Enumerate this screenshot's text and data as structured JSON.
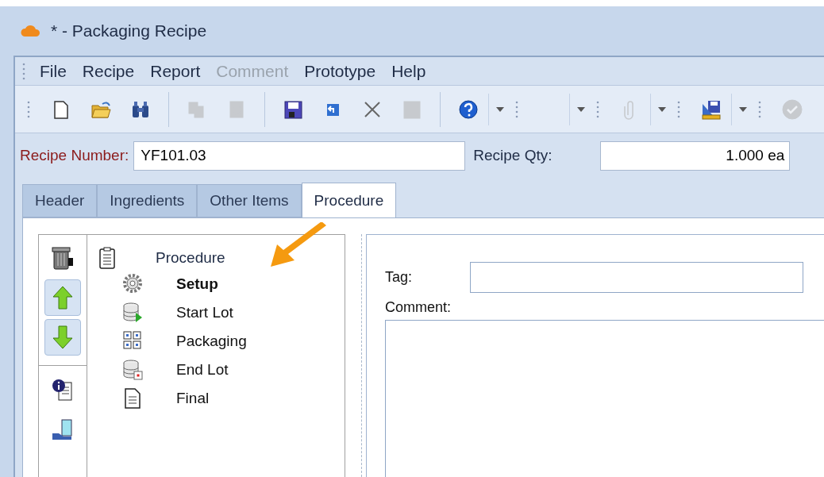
{
  "window": {
    "title": "* - Packaging Recipe"
  },
  "menu": [
    {
      "label": "File",
      "disabled": false
    },
    {
      "label": "Recipe",
      "disabled": false
    },
    {
      "label": "Report",
      "disabled": false
    },
    {
      "label": "Comment",
      "disabled": true
    },
    {
      "label": "Prototype",
      "disabled": false
    },
    {
      "label": "Help",
      "disabled": false
    }
  ],
  "toolbars": [
    {
      "groups": [
        [
          {
            "kind": "button",
            "disabled": false
          },
          {
            "kind": "button",
            "disabled": false
          },
          {
            "kind": "button",
            "disabled": false
          }
        ],
        [
          {
            "kind": "button",
            "disabled": true
          },
          {
            "kind": "button",
            "disabled": true
          }
        ],
        [
          {
            "kind": "button",
            "disabled": false
          },
          {
            "kind": "button",
            "disabled": false
          },
          {
            "kind": "button",
            "disabled": false
          },
          {
            "kind": "button",
            "disabled": true
          }
        ],
        [
          {
            "kind": "button",
            "disabled": false
          },
          {
            "kind": "dropdown"
          }
        ]
      ]
    },
    {
      "groups": [
        [
          {
            "kind": "blank"
          },
          {
            "kind": "dropdown"
          }
        ]
      ]
    },
    {
      "groups": [
        [
          {
            "kind": "button",
            "disabled": true
          },
          {
            "kind": "dropdown"
          }
        ]
      ]
    },
    {
      "groups": [
        [
          {
            "kind": "button",
            "disabled": false
          },
          {
            "kind": "dropdown"
          }
        ]
      ]
    },
    {
      "groups": [
        [
          {
            "kind": "button",
            "disabled": true
          }
        ]
      ]
    }
  ],
  "recipe_number": {
    "label": "Recipe Number:",
    "value": "YF101.03",
    "required": true
  },
  "recipe_qty": {
    "label": "Recipe Qty:",
    "value": "1.000 ea",
    "required": false
  },
  "tabs": [
    {
      "label": "Header",
      "selected": false
    },
    {
      "label": "Ingredients",
      "selected": false
    },
    {
      "label": "Other Items",
      "selected": false
    },
    {
      "label": "Procedure",
      "selected": true
    }
  ],
  "tree": {
    "label": "Procedure",
    "selected": false,
    "children": [
      {
        "label": "Setup",
        "selected": true
      },
      {
        "label": "Start Lot",
        "selected": false
      },
      {
        "label": "Packaging",
        "selected": false
      },
      {
        "label": "End Lot",
        "selected": false
      },
      {
        "label": "Final",
        "selected": false
      }
    ]
  },
  "tag": {
    "label": "Tag:"
  },
  "comment": {
    "label": "Comment:"
  }
}
